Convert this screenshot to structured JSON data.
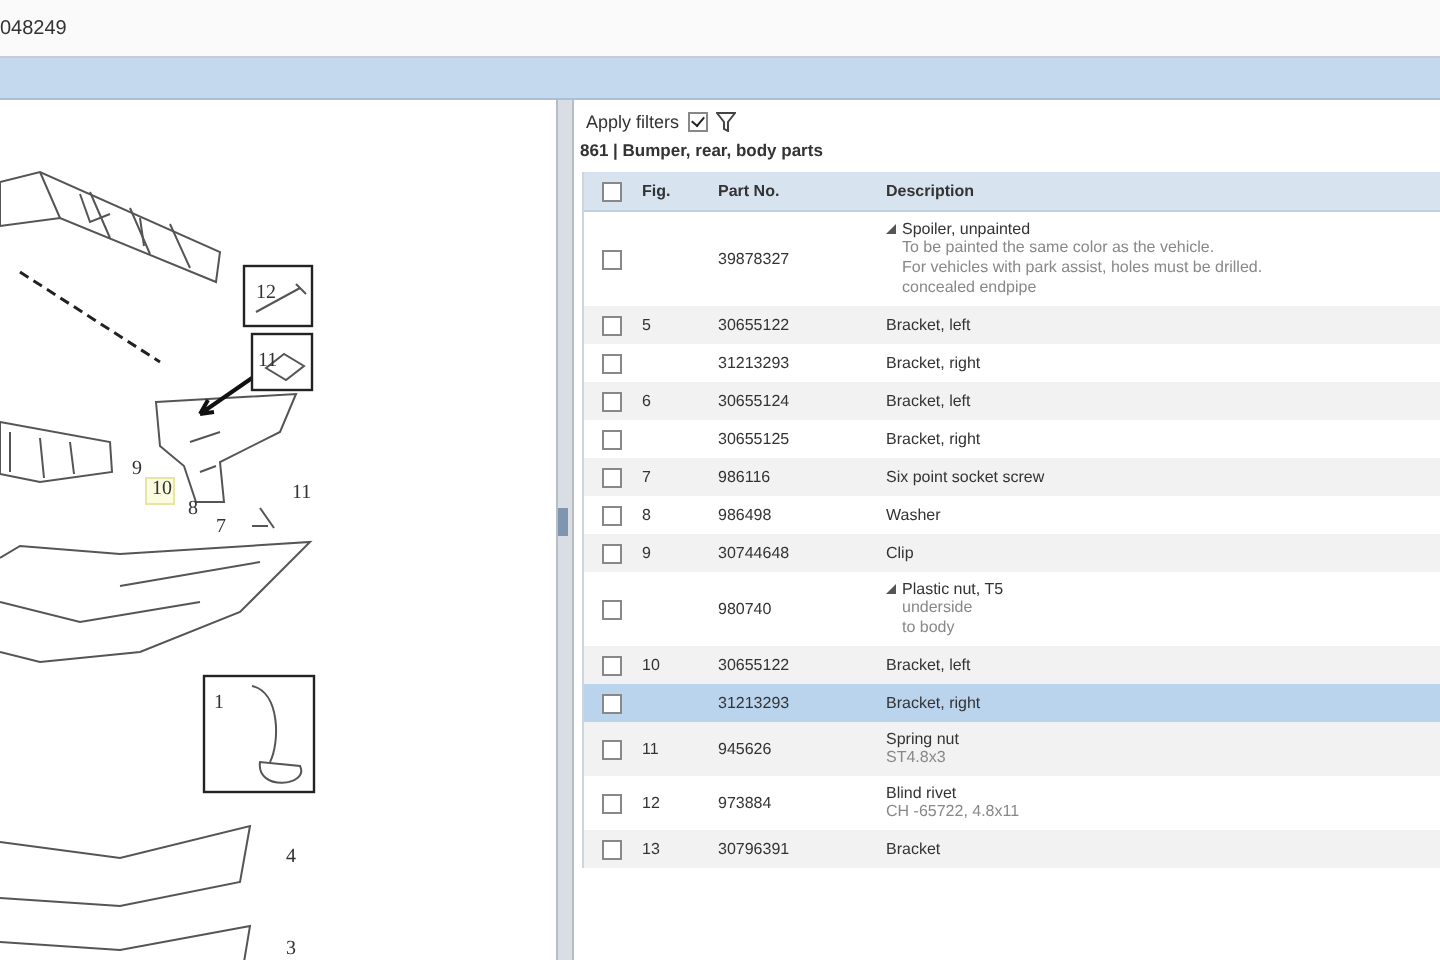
{
  "top_bar": {
    "text": "048249"
  },
  "diagram": {
    "callouts": [
      {
        "label": "12",
        "boxed": true,
        "highlighted": false
      },
      {
        "label": "11",
        "boxed": true,
        "highlighted": false
      },
      {
        "label": "9",
        "boxed": false,
        "highlighted": false
      },
      {
        "label": "10",
        "boxed": false,
        "highlighted": true
      },
      {
        "label": "8",
        "boxed": false,
        "highlighted": false
      },
      {
        "label": "7",
        "boxed": false,
        "highlighted": false
      },
      {
        "label": "11",
        "boxed": false,
        "highlighted": false
      },
      {
        "label": "1",
        "boxed": true,
        "highlighted": false
      },
      {
        "label": "4",
        "boxed": false,
        "highlighted": false
      },
      {
        "label": "3",
        "boxed": false,
        "highlighted": false
      }
    ]
  },
  "filters": {
    "label": "Apply filters",
    "checked": true
  },
  "group_title": "861 | Bumper, rear, body parts",
  "table": {
    "select_all_checked": false,
    "columns": [
      "Fig.",
      "Part No.",
      "Description"
    ],
    "rows": [
      {
        "fig": "",
        "part_no": "39878327",
        "description": "Spoiler, unpainted",
        "expanded": true,
        "notes": [
          "To be painted the same color as the vehicle.",
          "For vehicles with park assist, holes must be drilled.",
          "concealed endpipe"
        ],
        "checked": false,
        "selected": false
      },
      {
        "fig": "5",
        "part_no": "30655122",
        "description": "Bracket, left",
        "checked": false,
        "selected": false
      },
      {
        "fig": "",
        "part_no": "31213293",
        "description": "Bracket, right",
        "checked": false,
        "selected": false
      },
      {
        "fig": "6",
        "part_no": "30655124",
        "description": "Bracket, left",
        "checked": false,
        "selected": false
      },
      {
        "fig": "",
        "part_no": "30655125",
        "description": "Bracket, right",
        "checked": false,
        "selected": false
      },
      {
        "fig": "7",
        "part_no": "986116",
        "description": "Six point socket screw",
        "checked": false,
        "selected": false
      },
      {
        "fig": "8",
        "part_no": "986498",
        "description": "Washer",
        "checked": false,
        "selected": false
      },
      {
        "fig": "9",
        "part_no": "30744648",
        "description": "Clip",
        "checked": false,
        "selected": false
      },
      {
        "fig": "",
        "part_no": "980740",
        "description": "Plastic nut, T5",
        "expanded": true,
        "notes": [
          "underside",
          "to body"
        ],
        "checked": false,
        "selected": false
      },
      {
        "fig": "10",
        "part_no": "30655122",
        "description": "Bracket, left",
        "checked": false,
        "selected": false
      },
      {
        "fig": "",
        "part_no": "31213293",
        "description": "Bracket, right",
        "checked": false,
        "selected": true
      },
      {
        "fig": "11",
        "part_no": "945626",
        "description": "Spring nut",
        "notes": [
          "ST4.8x3"
        ],
        "checked": false,
        "selected": false
      },
      {
        "fig": "12",
        "part_no": "973884",
        "description": "Blind rivet",
        "notes": [
          "CH -65722, 4.8x11"
        ],
        "checked": false,
        "selected": false
      },
      {
        "fig": "13",
        "part_no": "30796391",
        "description": "Bracket",
        "checked": false,
        "selected": false
      }
    ]
  }
}
